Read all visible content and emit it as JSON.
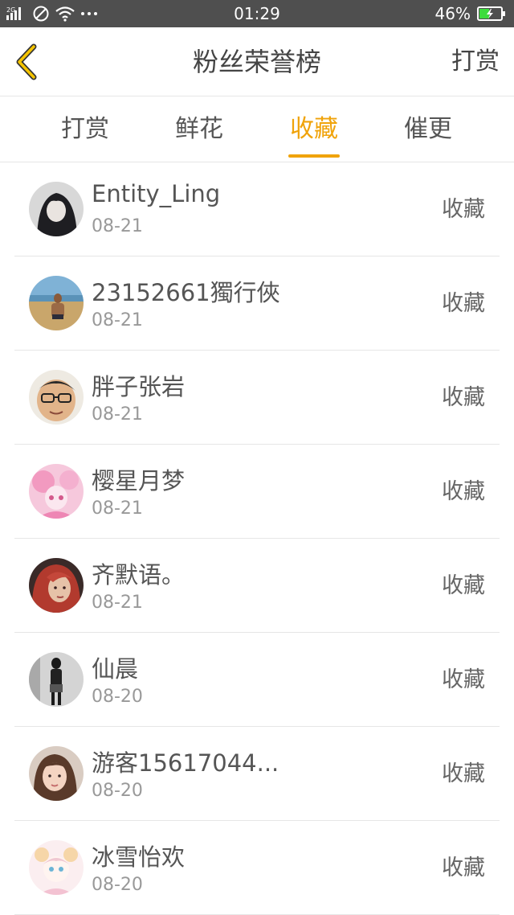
{
  "status_bar": {
    "network": "2G",
    "time": "01:29",
    "battery_percent": "46%",
    "battery_level": 0.46
  },
  "header": {
    "title": "粉丝荣誉榜",
    "action": "打赏"
  },
  "tabs": [
    {
      "label": "打赏"
    },
    {
      "label": "鲜花"
    },
    {
      "label": "收藏"
    },
    {
      "label": "催更"
    }
  ],
  "active_tab": 2,
  "accent_color": "#f0a30a",
  "rows": [
    {
      "name": "Entity_Ling",
      "date": "08-21",
      "action": "收藏"
    },
    {
      "name": "23152661獨行俠",
      "date": "08-21",
      "action": "收藏"
    },
    {
      "name": "胖子张岩",
      "date": "08-21",
      "action": "收藏"
    },
    {
      "name": "樱星月梦",
      "date": "08-21",
      "action": "收藏"
    },
    {
      "name": "齐默语。",
      "date": "08-21",
      "action": "收藏"
    },
    {
      "name": "仙晨",
      "date": "08-20",
      "action": "收藏"
    },
    {
      "name": "游客15617044...",
      "date": "08-20",
      "action": "收藏"
    },
    {
      "name": "冰雪怡欢",
      "date": "08-20",
      "action": "收藏"
    }
  ]
}
